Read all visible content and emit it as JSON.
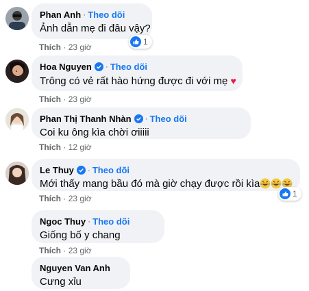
{
  "follow_label": "Theo dõi",
  "like_label": "Thích",
  "separator": "·",
  "colors": {
    "bubble": "#f0f2f5",
    "link": "#1877f2",
    "muted": "#65676b",
    "like_reaction": "#1877f2",
    "heart": "#e41e3f"
  },
  "comments": [
    {
      "name": "Phan Anh",
      "verified": false,
      "text": "Ảnh dẫn mẹ đi đâu vậy?",
      "time": "23 giờ",
      "reactions": {
        "icon": "thumbs-up-icon",
        "count": "1"
      }
    },
    {
      "name": "Hoa Nguyen",
      "verified": true,
      "text": "Trông có vẻ rất hào hứng được đi với mẹ",
      "emoji": "heart-emoji",
      "time": "23 giờ"
    },
    {
      "name": "Phan Thị Thanh Nhàn",
      "verified": true,
      "text": "Coi ku ông kìa chời ơiiiii",
      "time": "12 giờ"
    },
    {
      "name": "Le Thuy",
      "verified": true,
      "text": "Mới thấy mang bầu đó mà giờ chạy được rồi kìa",
      "emoji": "laughing-emoji x3",
      "time": "23 giờ",
      "reactions": {
        "icon": "thumbs-up-icon",
        "count": "1"
      }
    },
    {
      "name": "Ngoc Thuy",
      "verified": false,
      "text": "Giống bố y chang",
      "time": "23 giờ"
    },
    {
      "name": "Nguyen Van Anh",
      "verified": false,
      "text": "Cưng xỉu"
    }
  ]
}
